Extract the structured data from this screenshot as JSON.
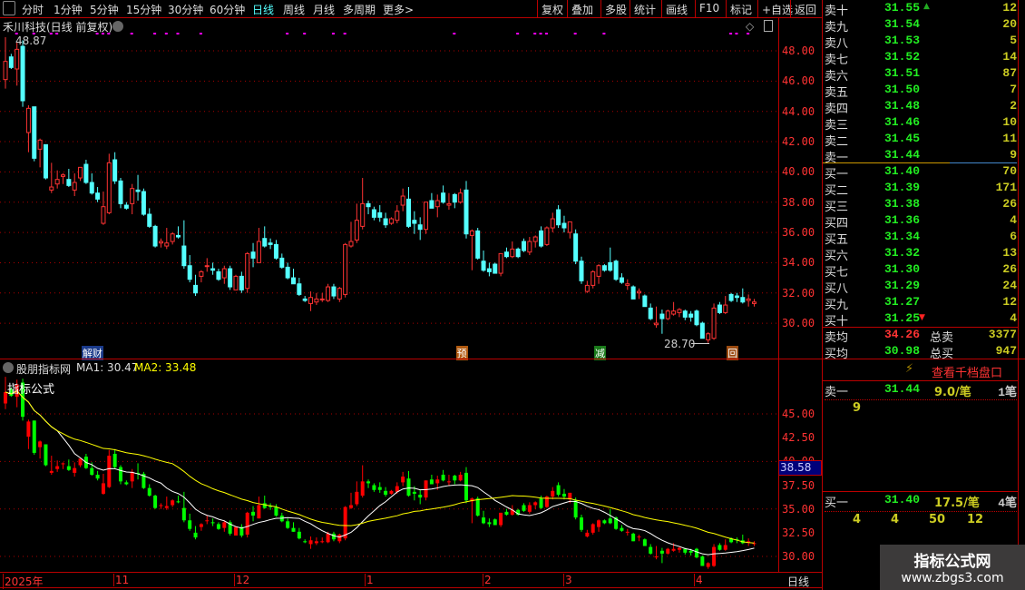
{
  "toolbar": {
    "periods": [
      "分时",
      "1分钟",
      "5分钟",
      "15分钟",
      "30分钟",
      "60分钟",
      "日线",
      "周线",
      "月线",
      "多周期",
      "更多>"
    ],
    "active": "日线",
    "right": [
      "复权",
      "叠加",
      "多股",
      "统计",
      "画线",
      "F10",
      "标记",
      "+自选",
      "返回"
    ]
  },
  "chart": {
    "title": "禾川科技(日线 前复权)",
    "high_label": "48.87",
    "low_label": "28.70",
    "price_ticks": [
      "48.00",
      "46.00",
      "44.00",
      "42.00",
      "40.00",
      "38.00",
      "36.00",
      "34.00",
      "32.00",
      "30.00"
    ],
    "badges": [
      {
        "text": "解财",
        "i": 14,
        "color": "#1a3a8a"
      },
      {
        "text": "预",
        "i": 79,
        "color": "#b05a10"
      },
      {
        "text": "减",
        "i": 103,
        "color": "#1a7a1a"
      },
      {
        "text": "回",
        "i": 126,
        "color": "#9a4a10"
      }
    ]
  },
  "indicator": {
    "name": "股朋指标网",
    "ma1": "MA1: 30.47",
    "ma2": "MA2: 33.48",
    "overlay": "指标公式",
    "ticks": [
      "45.00",
      "42.50",
      "40.00",
      "37.50",
      "35.00",
      "32.50",
      "30.00"
    ],
    "cursor_price": "38.58"
  },
  "xaxis": {
    "labels": [
      "2025年",
      "11",
      "12",
      "1",
      "2",
      "3",
      "4"
    ],
    "period": "日线"
  },
  "orderbook": {
    "asks": [
      [
        "卖十",
        "31.55",
        "12"
      ],
      [
        "卖九",
        "31.54",
        "20"
      ],
      [
        "卖八",
        "31.53",
        "5"
      ],
      [
        "卖七",
        "31.52",
        "14"
      ],
      [
        "卖六",
        "31.51",
        "87"
      ],
      [
        "卖五",
        "31.50",
        "7"
      ],
      [
        "卖四",
        "31.48",
        "2"
      ],
      [
        "卖三",
        "31.46",
        "10"
      ],
      [
        "卖二",
        "31.45",
        "11"
      ],
      [
        "卖一",
        "31.44",
        "9"
      ]
    ],
    "bids": [
      [
        "买一",
        "31.40",
        "70"
      ],
      [
        "买二",
        "31.39",
        "171"
      ],
      [
        "买三",
        "31.38",
        "26"
      ],
      [
        "买四",
        "31.36",
        "4"
      ],
      [
        "买五",
        "31.34",
        "6"
      ],
      [
        "买六",
        "31.32",
        "13"
      ],
      [
        "买七",
        "31.30",
        "26"
      ],
      [
        "买八",
        "31.29",
        "24"
      ],
      [
        "买九",
        "31.27",
        "12"
      ],
      [
        "买十",
        "31.25",
        "4"
      ]
    ],
    "avg_sell": {
      "label": "卖均",
      "price": "34.26",
      "total_label": "总卖",
      "total": "3377"
    },
    "avg_buy": {
      "label": "买均",
      "price": "30.98",
      "total_label": "总买",
      "total": "947"
    },
    "depth_link": "查看千档盘口",
    "sell1": {
      "label": "卖一",
      "price": "31.44",
      "per": "9.0/笔",
      "count": "1笔",
      "orders": [
        "9"
      ]
    },
    "buy1": {
      "label": "买一",
      "price": "31.40",
      "per": "17.5/笔",
      "count": "4笔",
      "orders": [
        "4",
        "4",
        "50",
        "12"
      ]
    }
  },
  "watermark": {
    "title": "指标公式网",
    "url": "www.zbgs3.com"
  },
  "chart_data": {
    "type": "candlestick",
    "ylim_main": [
      28,
      49.5
    ],
    "ma_periods": [
      10,
      30
    ],
    "markers": [
      2,
      5,
      8,
      9,
      16,
      17,
      18,
      22,
      26,
      28,
      30,
      34,
      49,
      52,
      57,
      59,
      78,
      89,
      92,
      93,
      94,
      99,
      104,
      126,
      127,
      129
    ],
    "ohlc": [
      [
        46.1,
        48.9,
        45.5,
        47.3
      ],
      [
        47.6,
        47.8,
        46.8,
        46.9
      ],
      [
        46.8,
        48.6,
        45.7,
        48.1
      ],
      [
        48.3,
        48.7,
        44.3,
        44.7
      ],
      [
        42.6,
        44.4,
        41.3,
        44.2
      ],
      [
        44.3,
        44.3,
        40.7,
        40.9
      ],
      [
        41.5,
        42.2,
        40.3,
        42.1
      ],
      [
        41.8,
        41.8,
        39.5,
        39.6
      ],
      [
        38.8,
        40.6,
        38.6,
        39.0
      ],
      [
        39.2,
        40.1,
        38.9,
        39.5
      ],
      [
        39.7,
        39.9,
        39.2,
        39.8
      ],
      [
        39.5,
        40.2,
        39.0,
        39.1
      ],
      [
        38.8,
        39.9,
        38.4,
        39.3
      ],
      [
        39.6,
        40.3,
        39.4,
        40.3
      ],
      [
        40.5,
        40.8,
        39.2,
        39.3
      ],
      [
        39.3,
        39.9,
        38.5,
        38.6
      ],
      [
        38.6,
        39.0,
        38.0,
        38.2
      ],
      [
        36.6,
        38.7,
        36.5,
        37.7
      ],
      [
        37.3,
        41.2,
        37.2,
        40.6
      ],
      [
        40.8,
        41.3,
        39.2,
        39.4
      ],
      [
        39.4,
        39.6,
        37.6,
        37.9
      ],
      [
        37.8,
        38.0,
        37.5,
        37.6
      ],
      [
        37.9,
        39.2,
        37.2,
        38.9
      ],
      [
        38.8,
        39.8,
        38.1,
        38.7
      ],
      [
        38.7,
        38.9,
        37.1,
        37.2
      ],
      [
        37.2,
        37.6,
        36.3,
        36.4
      ],
      [
        36.4,
        36.5,
        35.0,
        35.1
      ],
      [
        35.3,
        35.6,
        35.0,
        35.4
      ],
      [
        35.1,
        36.3,
        34.9,
        35.3
      ],
      [
        35.4,
        36.0,
        35.2,
        35.9
      ],
      [
        35.8,
        36.4,
        35.6,
        35.7
      ],
      [
        35.1,
        36.8,
        33.6,
        33.8
      ],
      [
        33.8,
        34.5,
        32.7,
        32.9
      ],
      [
        32.5,
        33.2,
        31.8,
        32.0
      ],
      [
        33.1,
        33.5,
        32.7,
        33.4
      ],
      [
        33.8,
        34.3,
        33.4,
        33.8
      ],
      [
        33.6,
        34.0,
        33.2,
        33.5
      ],
      [
        33.4,
        33.6,
        32.8,
        32.9
      ],
      [
        33.0,
        33.8,
        32.6,
        33.6
      ],
      [
        33.6,
        33.8,
        32.2,
        32.4
      ],
      [
        32.2,
        33.2,
        32.2,
        33.1
      ],
      [
        33.1,
        33.4,
        32.0,
        32.2
      ],
      [
        32.3,
        34.7,
        32.0,
        34.6
      ],
      [
        34.7,
        35.3,
        33.7,
        34.3
      ],
      [
        34.0,
        36.3,
        34.0,
        35.4
      ],
      [
        35.6,
        36.4,
        35.0,
        35.1
      ],
      [
        35.3,
        35.6,
        34.9,
        35.2
      ],
      [
        35.2,
        35.5,
        34.2,
        34.3
      ],
      [
        34.3,
        34.6,
        33.6,
        33.7
      ],
      [
        33.7,
        34.0,
        32.9,
        33.0
      ],
      [
        33.0,
        33.6,
        32.6,
        32.6
      ],
      [
        32.6,
        33.0,
        31.8,
        31.9
      ],
      [
        31.6,
        31.8,
        31.4,
        31.5
      ],
      [
        31.3,
        32.1,
        30.8,
        31.7
      ],
      [
        31.4,
        32.0,
        31.2,
        31.6
      ],
      [
        31.6,
        32.0,
        31.4,
        31.6
      ],
      [
        31.5,
        32.6,
        31.4,
        32.4
      ],
      [
        32.4,
        32.6,
        31.6,
        31.8
      ],
      [
        31.6,
        32.4,
        31.4,
        32.3
      ],
      [
        31.9,
        35.3,
        31.7,
        35.2
      ],
      [
        35.1,
        36.7,
        35.0,
        35.4
      ],
      [
        35.5,
        37.9,
        35.3,
        36.8
      ],
      [
        36.4,
        39.6,
        36.2,
        37.9
      ],
      [
        37.9,
        38.1,
        37.2,
        37.7
      ],
      [
        37.5,
        37.7,
        36.8,
        37.0
      ],
      [
        37.3,
        37.8,
        36.7,
        37.0
      ],
      [
        36.9,
        37.3,
        36.3,
        36.5
      ],
      [
        36.6,
        37.0,
        36.5,
        36.9
      ],
      [
        36.8,
        37.8,
        36.6,
        37.4
      ],
      [
        37.8,
        38.9,
        37.4,
        38.4
      ],
      [
        38.2,
        39.0,
        36.3,
        36.4
      ],
      [
        36.8,
        37.4,
        35.9,
        36.6
      ],
      [
        36.5,
        37.0,
        35.5,
        36.2
      ],
      [
        36.2,
        38.0,
        35.9,
        38.0
      ],
      [
        38.1,
        38.6,
        37.6,
        37.6
      ],
      [
        37.7,
        38.5,
        37.0,
        38.1
      ],
      [
        38.6,
        39.1,
        37.9,
        38.0
      ],
      [
        37.8,
        38.6,
        37.5,
        37.9
      ],
      [
        38.5,
        38.6,
        37.6,
        38.0
      ],
      [
        38.0,
        38.9,
        37.9,
        38.6
      ],
      [
        38.8,
        39.4,
        35.6,
        35.9
      ],
      [
        35.8,
        36.2,
        33.5,
        36.1
      ],
      [
        36.1,
        36.3,
        34.2,
        34.3
      ],
      [
        34.1,
        34.8,
        33.4,
        33.5
      ],
      [
        33.6,
        34.0,
        33.1,
        33.4
      ],
      [
        33.9,
        34.0,
        33.3,
        33.3
      ],
      [
        33.3,
        34.6,
        33.1,
        34.6
      ],
      [
        34.7,
        35.0,
        34.3,
        34.4
      ],
      [
        34.4,
        35.4,
        34.3,
        34.9
      ],
      [
        34.9,
        35.0,
        34.3,
        34.4
      ],
      [
        35.4,
        35.6,
        34.7,
        34.8
      ],
      [
        34.7,
        35.7,
        34.5,
        35.4
      ],
      [
        35.4,
        35.8,
        35.0,
        35.7
      ],
      [
        36.1,
        36.4,
        35.0,
        35.1
      ],
      [
        35.2,
        36.4,
        35.1,
        36.3
      ],
      [
        36.3,
        37.3,
        36.0,
        36.9
      ],
      [
        37.5,
        37.8,
        36.3,
        36.5
      ],
      [
        36.6,
        37.1,
        36.0,
        36.3
      ],
      [
        36.0,
        36.7,
        35.6,
        36.7
      ],
      [
        35.9,
        36.2,
        33.9,
        34.1
      ],
      [
        34.1,
        34.4,
        32.6,
        32.8
      ],
      [
        32.1,
        32.8,
        32.0,
        32.5
      ],
      [
        32.5,
        33.5,
        32.3,
        33.4
      ],
      [
        33.1,
        33.9,
        32.6,
        33.8
      ],
      [
        33.8,
        33.9,
        33.4,
        33.5
      ],
      [
        34.0,
        35.0,
        33.4,
        33.5
      ],
      [
        34.1,
        34.2,
        32.8,
        32.9
      ],
      [
        33.0,
        33.3,
        32.6,
        32.7
      ],
      [
        32.5,
        32.9,
        32.2,
        32.6
      ],
      [
        32.4,
        32.5,
        31.6,
        31.6
      ],
      [
        32.0,
        32.3,
        31.6,
        32.1
      ],
      [
        31.8,
        31.9,
        31.1,
        31.1
      ],
      [
        31.0,
        31.3,
        30.2,
        30.3
      ],
      [
        29.9,
        31.1,
        29.7,
        30.0
      ],
      [
        30.6,
        30.9,
        29.3,
        30.3
      ],
      [
        30.3,
        30.9,
        30.2,
        30.8
      ],
      [
        30.6,
        31.4,
        30.5,
        30.8
      ],
      [
        30.7,
        31.0,
        30.4,
        30.9
      ],
      [
        30.8,
        30.9,
        30.2,
        30.4
      ],
      [
        30.6,
        30.8,
        30.1,
        30.4
      ],
      [
        30.8,
        30.9,
        29.8,
        29.9
      ],
      [
        30.0,
        30.1,
        29.0,
        29.0
      ],
      [
        28.9,
        29.4,
        28.7,
        29.3
      ],
      [
        29.0,
        31.3,
        28.9,
        31.0
      ],
      [
        31.2,
        31.4,
        30.6,
        30.7
      ],
      [
        30.7,
        31.8,
        30.6,
        31.2
      ],
      [
        31.9,
        32.0,
        31.4,
        31.5
      ],
      [
        31.8,
        32.0,
        31.4,
        31.7
      ],
      [
        31.7,
        32.3,
        31.3,
        31.4
      ],
      [
        31.5,
        31.9,
        31.1,
        31.6
      ],
      [
        31.3,
        31.6,
        31.1,
        31.4
      ]
    ]
  }
}
